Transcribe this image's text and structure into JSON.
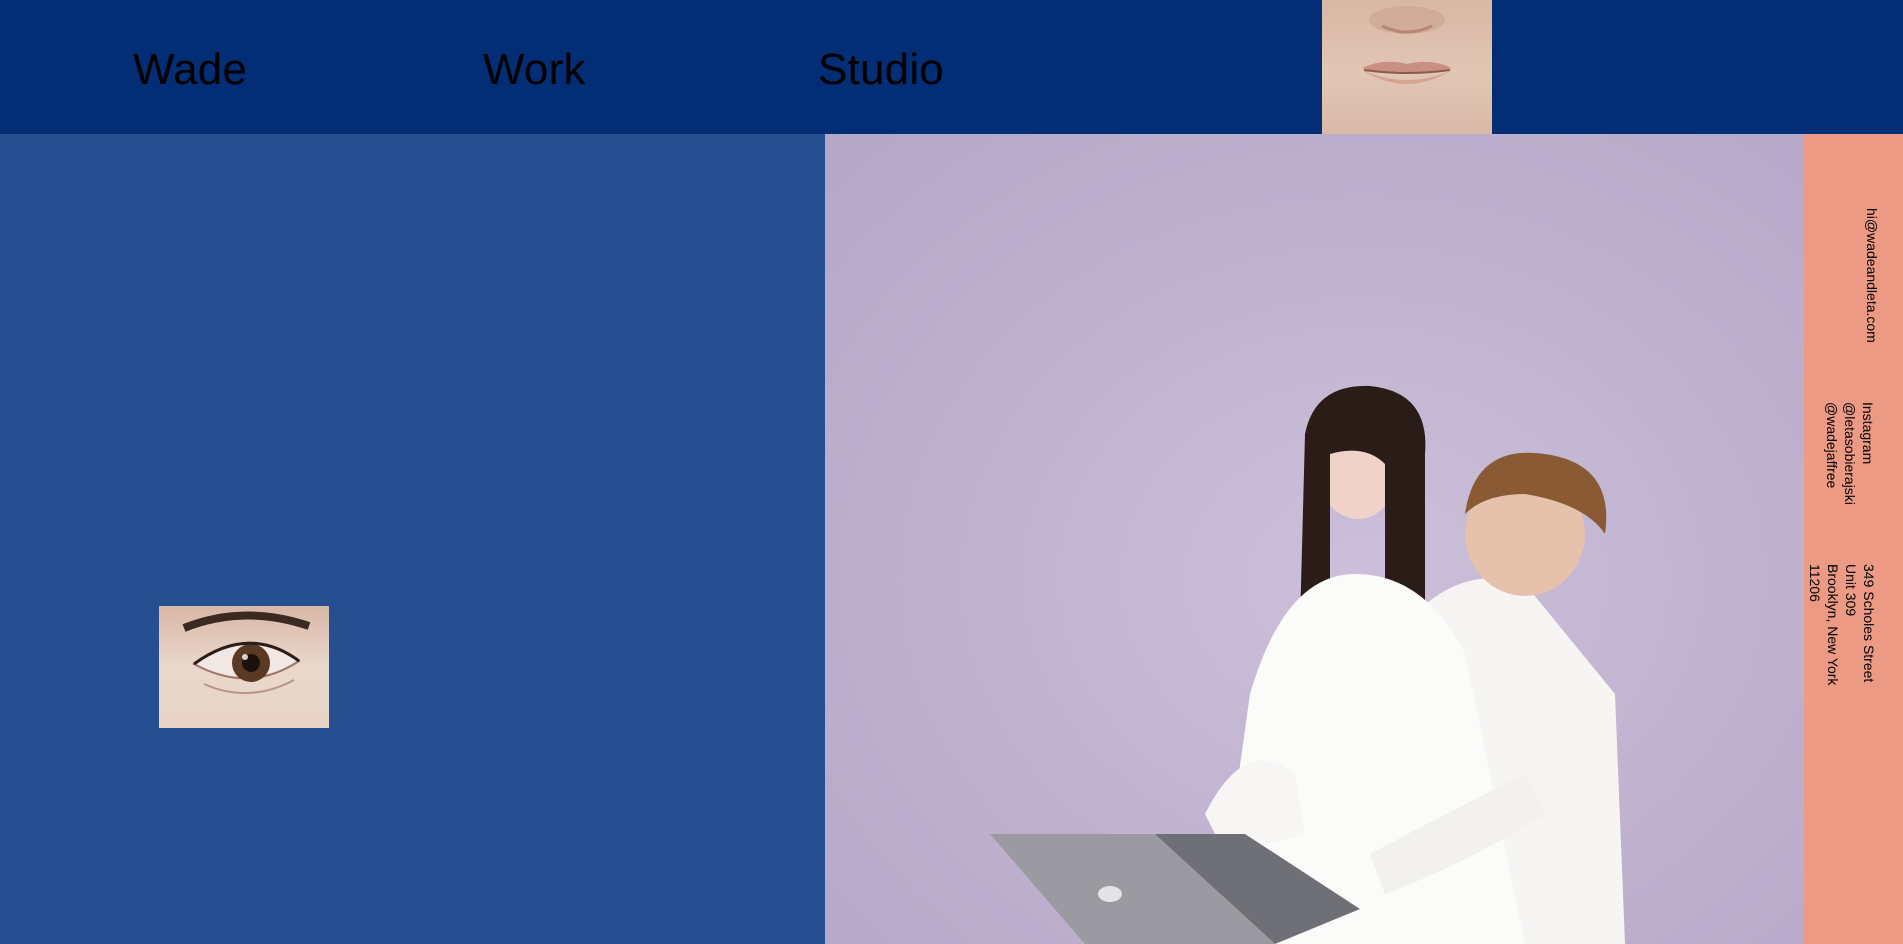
{
  "nav": {
    "items": [
      {
        "label": "Wade"
      },
      {
        "label": "Work"
      },
      {
        "label": "Studio"
      }
    ]
  },
  "contact": {
    "email": "hi@wadeandleta.com",
    "social_title": "Instagram",
    "handles": [
      "@letasobierajski",
      "@wadejaffree"
    ],
    "address_lines": [
      "349 Scholes Street",
      "Unit 309",
      "Brooklyn, New York",
      "11206"
    ]
  },
  "colors": {
    "header": "#032d74",
    "left_panel": "#254f91",
    "photo_bg": "#beb2cf",
    "contact_strip": "#ec9a84"
  },
  "images": {
    "mouth": "mouth-closeup-image",
    "eye": "eye-closeup-image",
    "hero": "portrait-photo-laptop"
  }
}
